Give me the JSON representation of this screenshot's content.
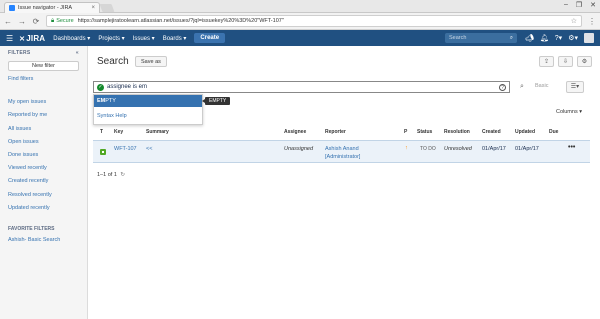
{
  "browser": {
    "tab_title": "Issue navigator - JIRA",
    "tab_close": "×",
    "window_buttons": [
      "–",
      "❐",
      "✕"
    ],
    "nav": [
      "←",
      "→",
      "⟳"
    ],
    "secure_label": "Secure",
    "url": "https://samplejiratoolearn.atlassian.net/issues/?jql=issuekey%20%3D%20\"WFT-107\"",
    "menu_glyph": "⋮"
  },
  "header": {
    "logo_text": "JIRA",
    "menus": [
      "Dashboards ▾",
      "Projects ▾",
      "Issues ▾",
      "Boards ▾"
    ],
    "create_label": "Create",
    "search_placeholder": "Search",
    "icons": [
      "megaphone-icon",
      "bell-icon",
      "help-icon",
      "gear-icon"
    ]
  },
  "sidebar": {
    "title": "FILTERS",
    "collapse_glyph": "«",
    "new_filter_label": "New filter",
    "find_filters_label": "Find filters",
    "items": [
      "My open issues",
      "Reported by me",
      "All issues",
      "Open issues",
      "Done issues",
      "Viewed recently",
      "Created recently",
      "Resolved recently",
      "Updated recently"
    ],
    "favorites_title": "FAVORITE FILTERS",
    "favorites": [
      "Ashish- Basic Search"
    ]
  },
  "main": {
    "title": "Search",
    "save_as_label": "Save as",
    "jql_value": "assignee is em",
    "basic_label": "Basic",
    "dropdown": {
      "items": [
        {
          "bold": "EM",
          "rest": "PTY"
        },
        {
          "label": "Syntax Help"
        }
      ],
      "tooltip": "EMPTY"
    },
    "columns_label": "Columns ▾",
    "table": {
      "headers": [
        "T",
        "Key",
        "Summary",
        "Assignee",
        "Reporter",
        "P",
        "Status",
        "Resolution",
        "Created",
        "Updated",
        "Due"
      ],
      "rows": [
        {
          "key": "WFT-107",
          "summary": "<<",
          "assignee": "Unassigned",
          "reporter_line1": "Ashish Anand",
          "reporter_line2": "[Administrator]",
          "priority": "↑",
          "status": "TO DO",
          "resolution": "Unresolved",
          "created": "01/Apr/17",
          "updated": "01/Apr/17",
          "due": "",
          "actions": "•••"
        }
      ]
    },
    "pager": "1–1 of 1",
    "refresh_glyph": "↻"
  }
}
